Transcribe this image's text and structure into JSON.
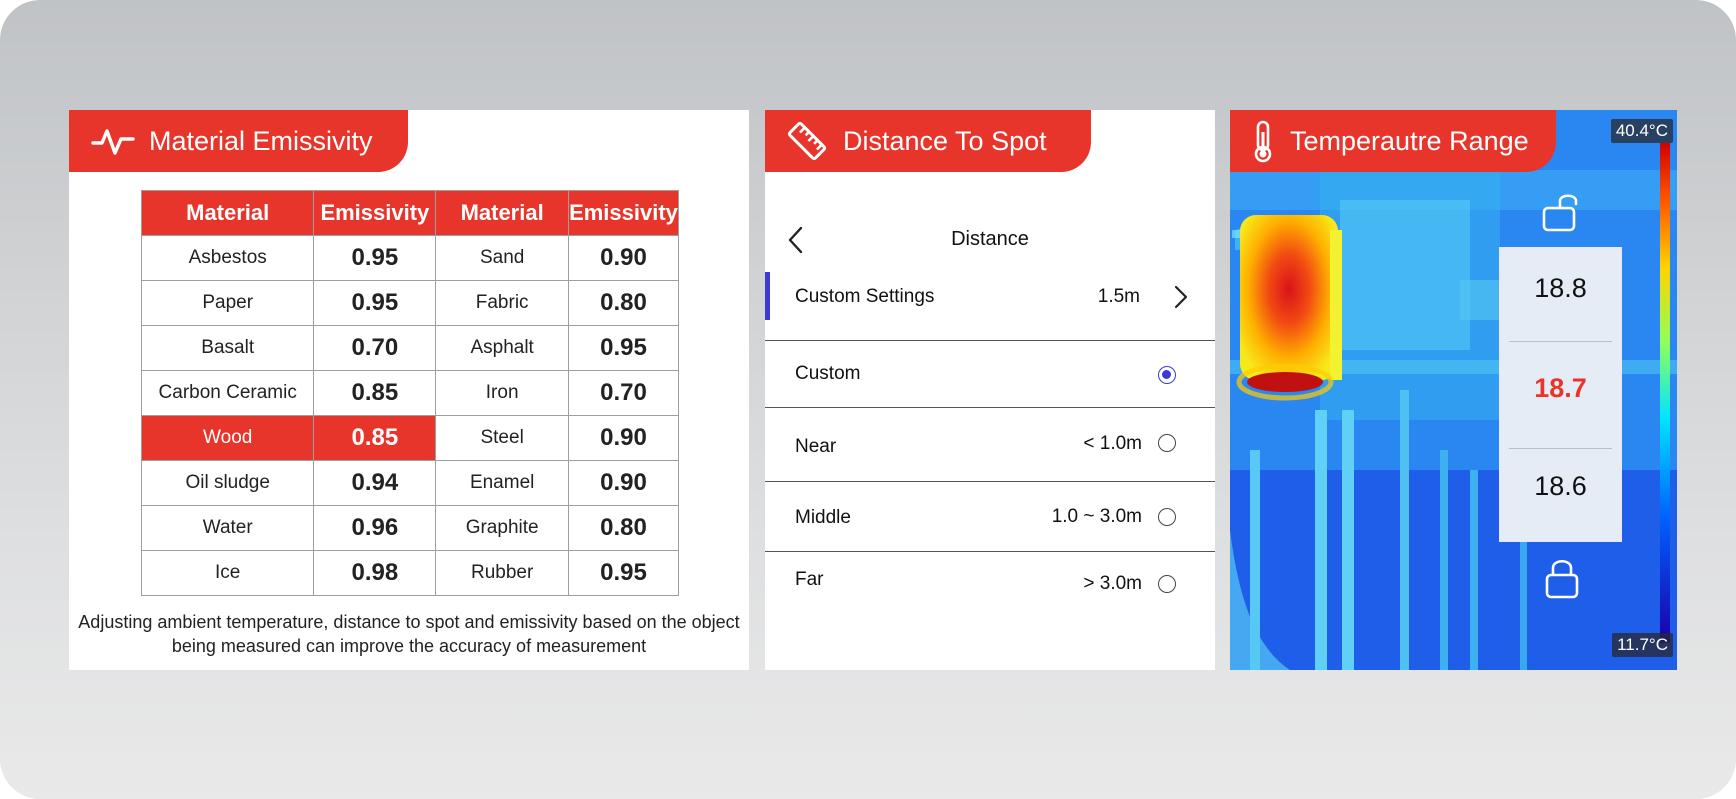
{
  "emissivity": {
    "title": "Material Emissivity",
    "icon": "pulse-icon",
    "headers": [
      "Material",
      "Emissivity",
      "Material",
      "Emissivity"
    ],
    "rows": [
      [
        "Asbestos",
        "0.95",
        "Sand",
        "0.90"
      ],
      [
        "Paper",
        "0.95",
        "Fabric",
        "0.80"
      ],
      [
        "Basalt",
        "0.70",
        "Asphalt",
        "0.95"
      ],
      [
        "Carbon Ceramic",
        "0.85",
        "Iron",
        "0.70"
      ],
      [
        "Wood",
        "0.85",
        "Steel",
        "0.90"
      ],
      [
        "Oil sludge",
        "0.94",
        "Enamel",
        "0.90"
      ],
      [
        "Water",
        "0.96",
        "Graphite",
        "0.80"
      ],
      [
        "Ice",
        "0.98",
        "Rubber",
        "0.95"
      ]
    ],
    "highlighted_material": "Wood",
    "note": "Adjusting ambient temperature, distance to spot and emissivity based on the object being measured can improve the accuracy of measurement"
  },
  "distance": {
    "title": "Distance To Spot",
    "icon": "ruler-icon",
    "screen_title": "Distance",
    "custom_settings": {
      "label": "Custom Settings",
      "value": "1.5m"
    },
    "options": [
      {
        "label": "Custom",
        "value": "",
        "selected": true
      },
      {
        "label": "Near",
        "value": "< 1.0m",
        "selected": false
      },
      {
        "label": "Middle",
        "value": "1.0 ~ 3.0m",
        "selected": false
      },
      {
        "label": "Far",
        "value": "> 3.0m",
        "selected": false
      }
    ],
    "accent_color": "#3b3bd1"
  },
  "temperature": {
    "title": "Temperautre Range",
    "icon": "thermometer-icon",
    "max_label": "40.4°C",
    "min_label": "11.7°C",
    "readings": [
      "18.8",
      "18.7",
      "18.6"
    ],
    "current_reading_index": 1
  },
  "colors": {
    "brand_red": "#e8352b"
  }
}
